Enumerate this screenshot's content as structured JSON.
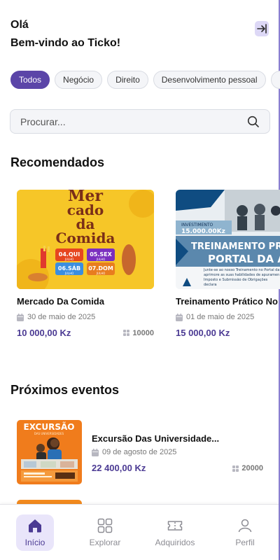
{
  "header": {
    "greeting": "Olá",
    "welcome": "Bem-vindo ao Ticko!"
  },
  "categories": [
    {
      "label": "Todos",
      "active": true
    },
    {
      "label": "Negócio",
      "active": false
    },
    {
      "label": "Direito",
      "active": false
    },
    {
      "label": "Desenvolvimento pessoal",
      "active": false
    }
  ],
  "search": {
    "placeholder": "Procurar..."
  },
  "recommended": {
    "title": "Recomendados",
    "items": [
      {
        "title": "Mercado Da Comida",
        "date": "30 de maio de 2025",
        "price": "10 000,00 Kz",
        "count": "10000",
        "poster": {
          "top": "Mer",
          "mid": "cado",
          "line2": "da",
          "line3": "Comida",
          "slots": [
            {
              "day": "04.QUI",
              "month": "JULHO"
            },
            {
              "day": "05.SEX",
              "month": "JULHO"
            },
            {
              "day": "06.SÁB",
              "month": "JULHO"
            },
            {
              "day": "07.DOM",
              "month": "JULHO"
            }
          ]
        }
      },
      {
        "title": "Treinamento Prático No",
        "date": "01 de maio de 2025",
        "price": "15 000,00 Kz",
        "count": "",
        "poster": {
          "invest_label": "INVESTIMENTO",
          "invest_value": "15.000.00Kz",
          "headline1": "TREINAMENTO PRÁTI",
          "headline2": "PORTAL DA AGT",
          "blurb": "Junte-se ao nosso Treinamento no Portal da aprimore as suas habilidades de apuramen Imposto e Submissão de Obrigações declara"
        }
      }
    ]
  },
  "upcoming": {
    "title": "Próximos eventos",
    "items": [
      {
        "title": "Excursão Das Universidade...",
        "date": "09 de agosto de 2025",
        "price": "22 400,00 Kz",
        "count": "20000",
        "poster": {
          "headline": "EXCURSÃO",
          "sub": "DAS UNIVERSIDADES"
        }
      }
    ]
  },
  "nav": [
    {
      "label": "Início",
      "active": true
    },
    {
      "label": "Explorar",
      "active": false
    },
    {
      "label": "Adquiridos",
      "active": false
    },
    {
      "label": "Perfil",
      "active": false
    }
  ],
  "colors": {
    "brand": "#5b45a8",
    "price": "#4b3a93"
  }
}
